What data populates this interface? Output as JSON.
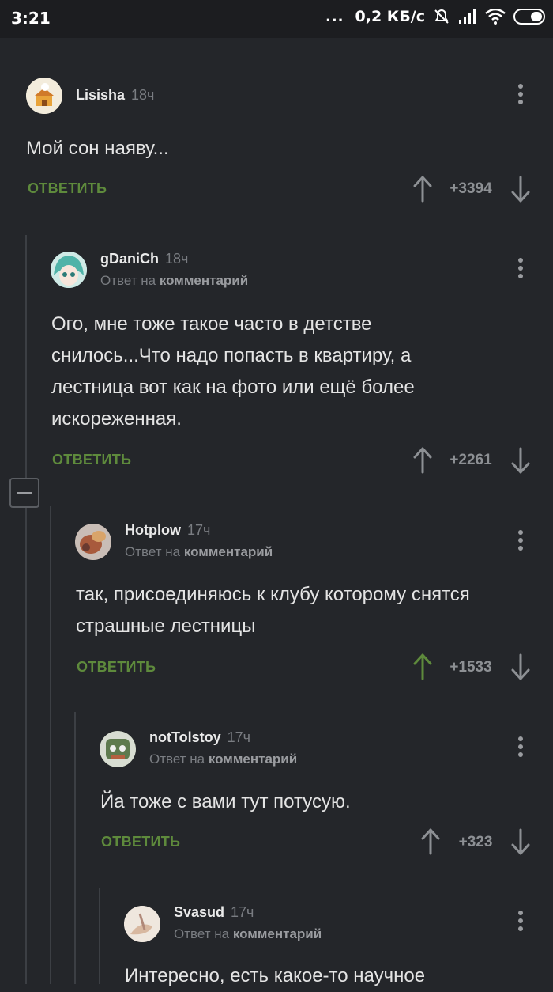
{
  "status": {
    "time": "3:21",
    "dots": "...",
    "speed": "0,2 КБ/с"
  },
  "comments": [
    {
      "username": "Lisisha",
      "age": "18ч",
      "text": "Мой сон наяву...",
      "reply_label": "ОТВЕТИТЬ",
      "score": "+3394",
      "upvoted": false
    },
    {
      "username": "gDaniCh",
      "age": "18ч",
      "reply_to_prefix": "Ответ на",
      "reply_to_target": "комментарий",
      "text": "Ого, мне тоже такое часто в детстве снилось...Что надо попасть в квартиру, а лестница вот как на фото или ещё более искореженная.",
      "reply_label": "ОТВЕТИТЬ",
      "score": "+2261",
      "upvoted": false
    },
    {
      "username": "Hotplow",
      "age": "17ч",
      "reply_to_prefix": "Ответ на",
      "reply_to_target": "комментарий",
      "text": "так, присоединяюсь к клубу которому снятся страшные лестницы",
      "reply_label": "ОТВЕТИТЬ",
      "score": "+1533",
      "upvoted": true
    },
    {
      "username": "notTolstoy",
      "age": "17ч",
      "reply_to_prefix": "Ответ на",
      "reply_to_target": "комментарий",
      "text": "Йа тоже с вами тут потусую.",
      "reply_label": "ОТВЕТИТЬ",
      "score": "+323",
      "upvoted": false
    },
    {
      "username": "Svasud",
      "age": "17ч",
      "reply_to_prefix": "Ответ на",
      "reply_to_target": "комментарий",
      "text": "Интересно, есть какое-то научное"
    }
  ],
  "colors": {
    "background": "#24262a",
    "reply_green": "#5e8a3c",
    "upvote_active": "#5e8a3c",
    "arrow_default": "#8d9094"
  }
}
